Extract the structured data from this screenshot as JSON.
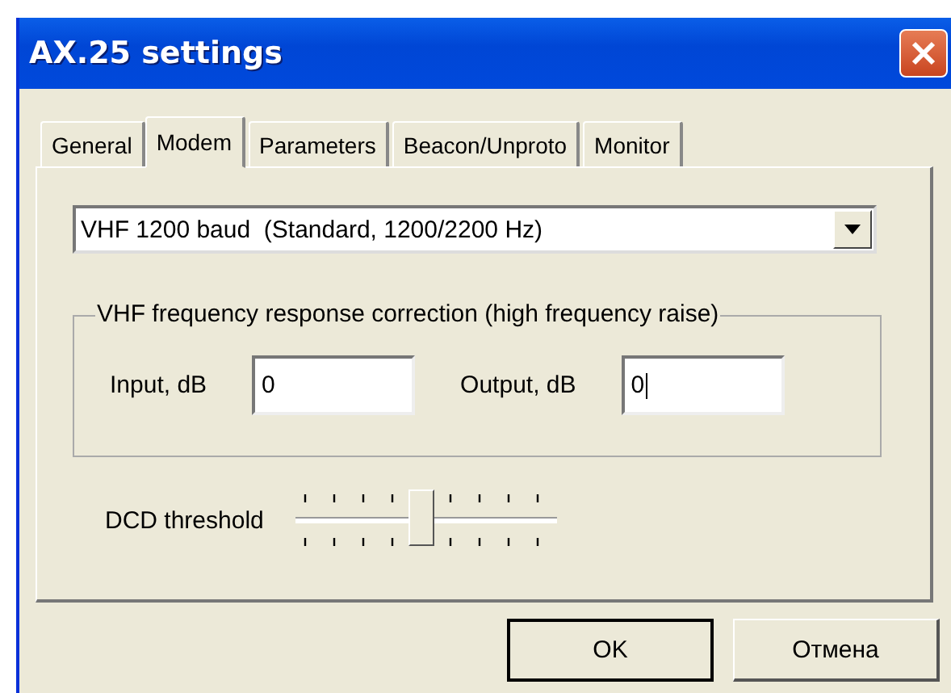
{
  "window": {
    "title": "AX.25 settings"
  },
  "tabs": [
    {
      "label": "General",
      "selected": false
    },
    {
      "label": "Modem",
      "selected": true
    },
    {
      "label": "Parameters",
      "selected": false
    },
    {
      "label": "Beacon/Unproto",
      "selected": false
    },
    {
      "label": "Monitor",
      "selected": false
    }
  ],
  "modem_dropdown": {
    "value": "VHF 1200 baud  (Standard, 1200/2200 Hz)"
  },
  "correction_group": {
    "title": "VHF frequency response correction (high frequency raise)",
    "fields": [
      {
        "label": "Input, dB",
        "value": "0",
        "focused": false
      },
      {
        "label": "Output, dB",
        "value": "0",
        "focused": true
      }
    ]
  },
  "dcd_threshold": {
    "label": "DCD threshold",
    "level": 0.5
  },
  "buttons": [
    {
      "label": "OK",
      "default": true
    },
    {
      "label": "Отмена",
      "default": false
    }
  ]
}
